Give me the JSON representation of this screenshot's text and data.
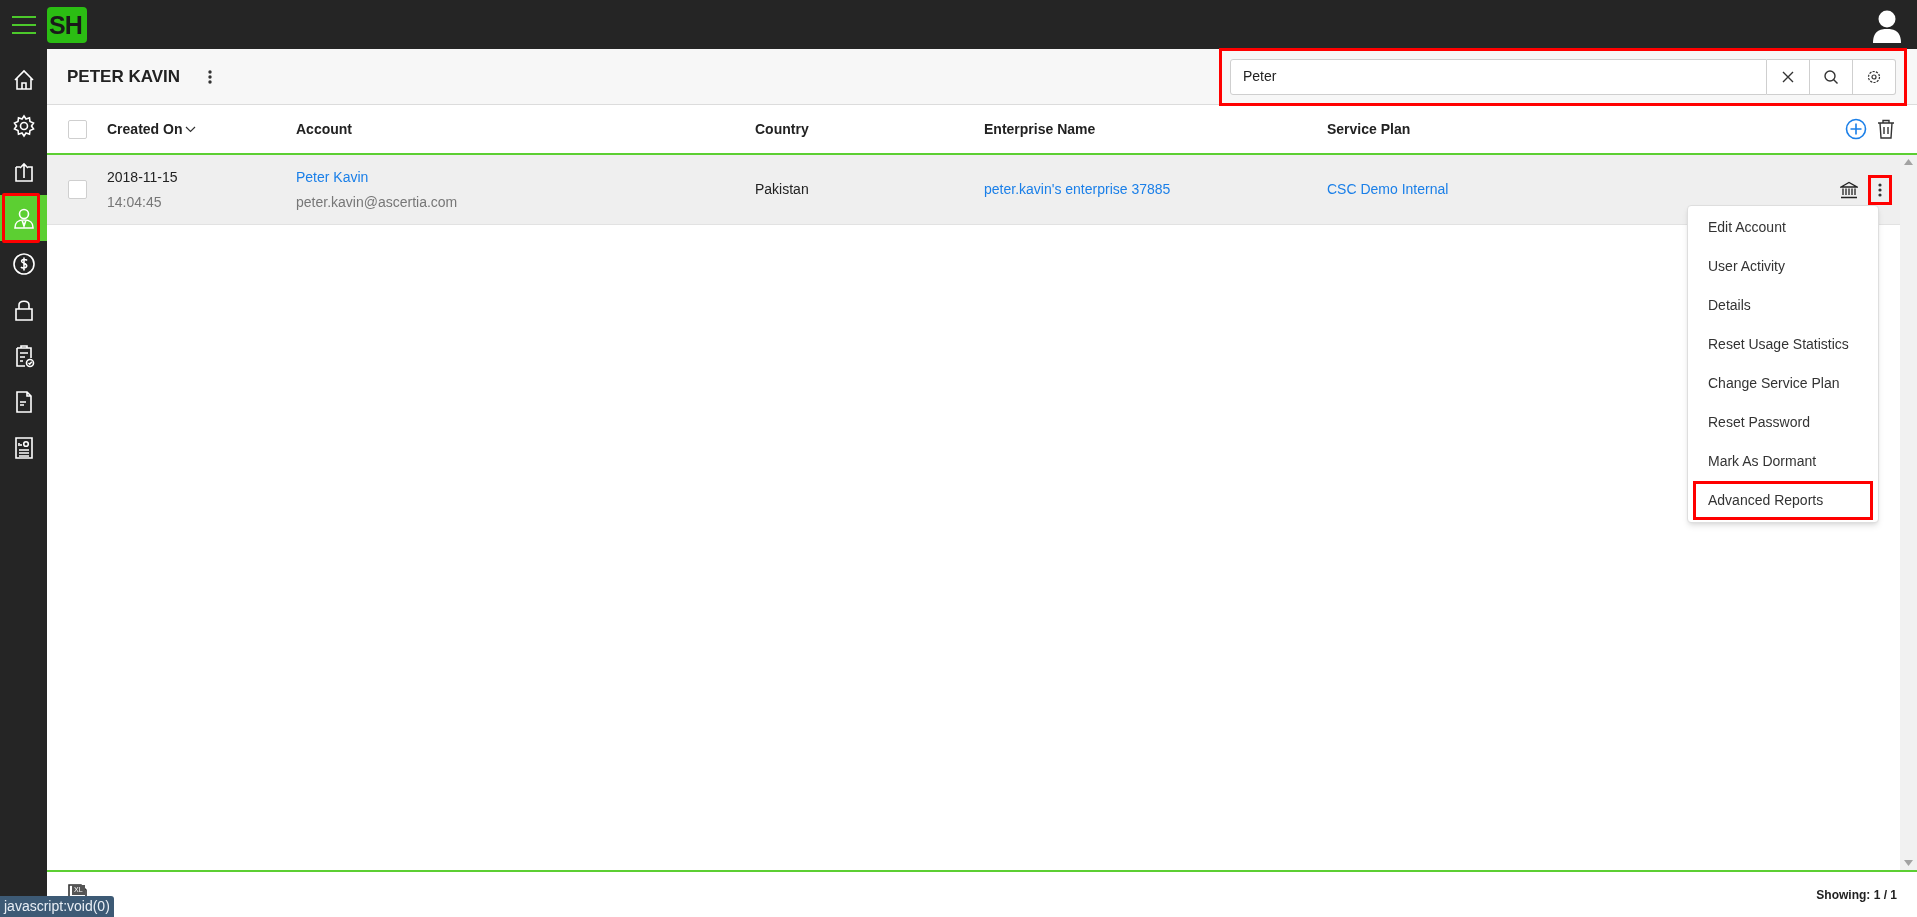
{
  "sidebar": {
    "items": [
      {
        "kind": "home",
        "selected": false,
        "highlighted": false
      },
      {
        "kind": "settings",
        "selected": false,
        "highlighted": false
      },
      {
        "kind": "upload",
        "selected": false,
        "highlighted": false
      },
      {
        "kind": "user",
        "selected": true,
        "highlighted": true
      },
      {
        "kind": "dollar",
        "selected": false,
        "highlighted": false
      },
      {
        "kind": "lock",
        "selected": false,
        "highlighted": false
      },
      {
        "kind": "checklist",
        "selected": false,
        "highlighted": false
      },
      {
        "kind": "document",
        "selected": false,
        "highlighted": false
      },
      {
        "kind": "report",
        "selected": false,
        "highlighted": false
      }
    ]
  },
  "logo": "SH",
  "page_title": "PETER KAVIN",
  "search": {
    "value": "Peter",
    "highlighted": true
  },
  "table": {
    "all_selected": false,
    "columns": [
      {
        "label": "Created On",
        "sorted": true
      },
      {
        "label": "Account",
        "sorted": false
      },
      {
        "label": "Country",
        "sorted": false
      },
      {
        "label": "Enterprise Name",
        "sorted": false
      },
      {
        "label": "Service Plan",
        "sorted": false
      }
    ],
    "rows": [
      {
        "checked": false,
        "date": "2018-11-15",
        "time": "14:04:45",
        "account_name": "Peter Kavin",
        "account_email": "peter.kavin@ascertia.com",
        "country": "Pakistan",
        "enterprise": "peter.kavin's enterprise 37885",
        "service_plan": "CSC Demo Internal",
        "menu_highlighted": true
      }
    ]
  },
  "row_menu": {
    "items": [
      {
        "label": "Edit Account",
        "highlighted": false
      },
      {
        "label": "User Activity",
        "highlighted": false
      },
      {
        "label": "Details",
        "highlighted": false
      },
      {
        "label": "Reset Usage Statistics",
        "highlighted": false
      },
      {
        "label": "Change Service Plan",
        "highlighted": false
      },
      {
        "label": "Reset Password",
        "highlighted": false
      },
      {
        "label": "Mark As Dormant",
        "highlighted": false
      },
      {
        "label": "Advanced Reports",
        "highlighted": true
      }
    ]
  },
  "footer": {
    "showing": "Showing: 1 / 1",
    "export_badge": "XL"
  },
  "status_link": "javascript:void(0)"
}
